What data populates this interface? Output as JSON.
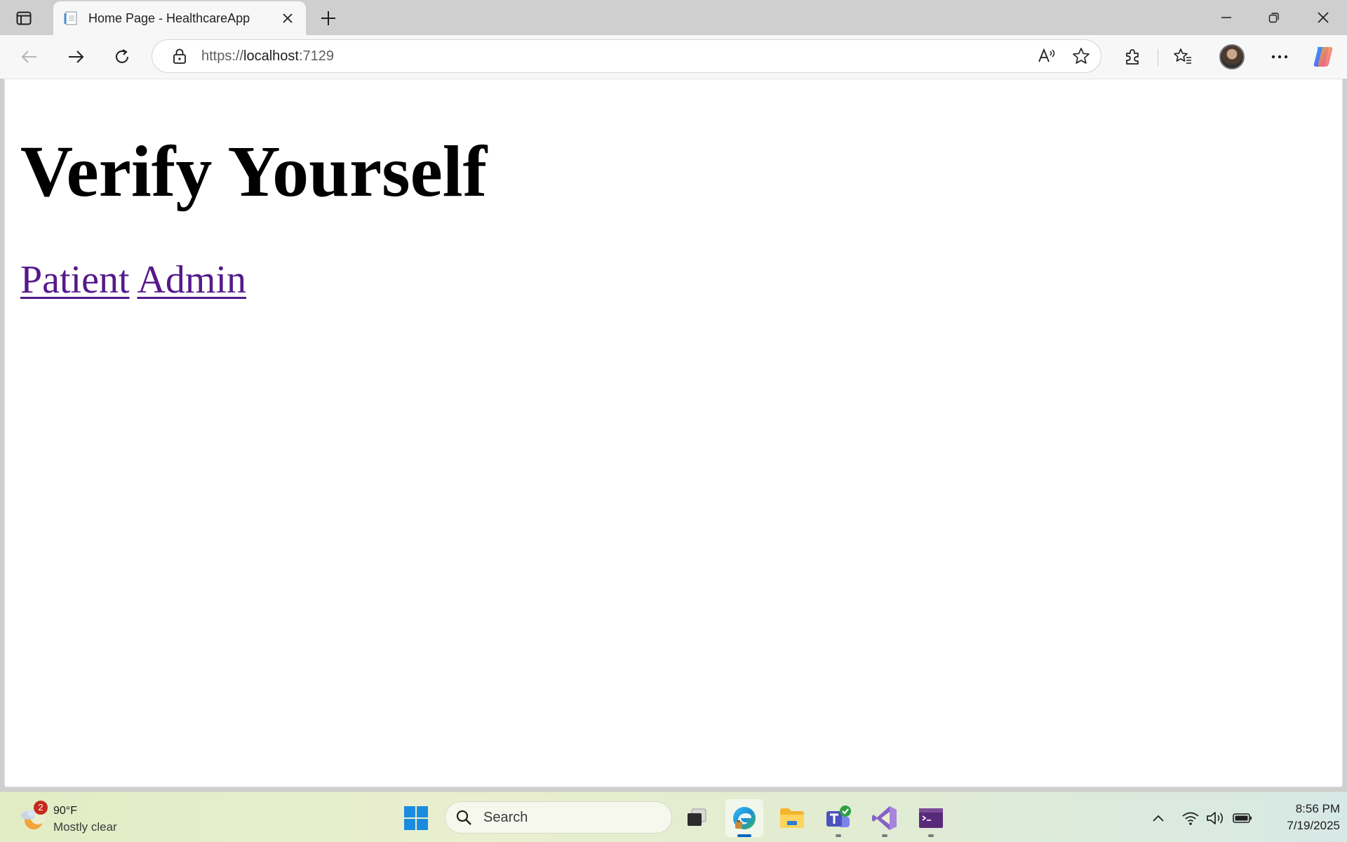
{
  "browser": {
    "tab": {
      "title": "Home Page - HealthcareApp",
      "favicon": "document-icon"
    },
    "address": {
      "scheme": "https://",
      "host": "localhost",
      "port": ":7129"
    }
  },
  "page": {
    "heading": "Verify Yourself",
    "links": [
      {
        "label": "Patient"
      },
      {
        "label": "Admin"
      }
    ],
    "link_color": "#551a8b"
  },
  "taskbar": {
    "weather": {
      "temp": "90°F",
      "condition": "Mostly clear",
      "badge": "2"
    },
    "search_placeholder": "Search",
    "clock": {
      "time": "8:56 PM",
      "date": "7/19/2025"
    },
    "accent": "#0067c0"
  }
}
